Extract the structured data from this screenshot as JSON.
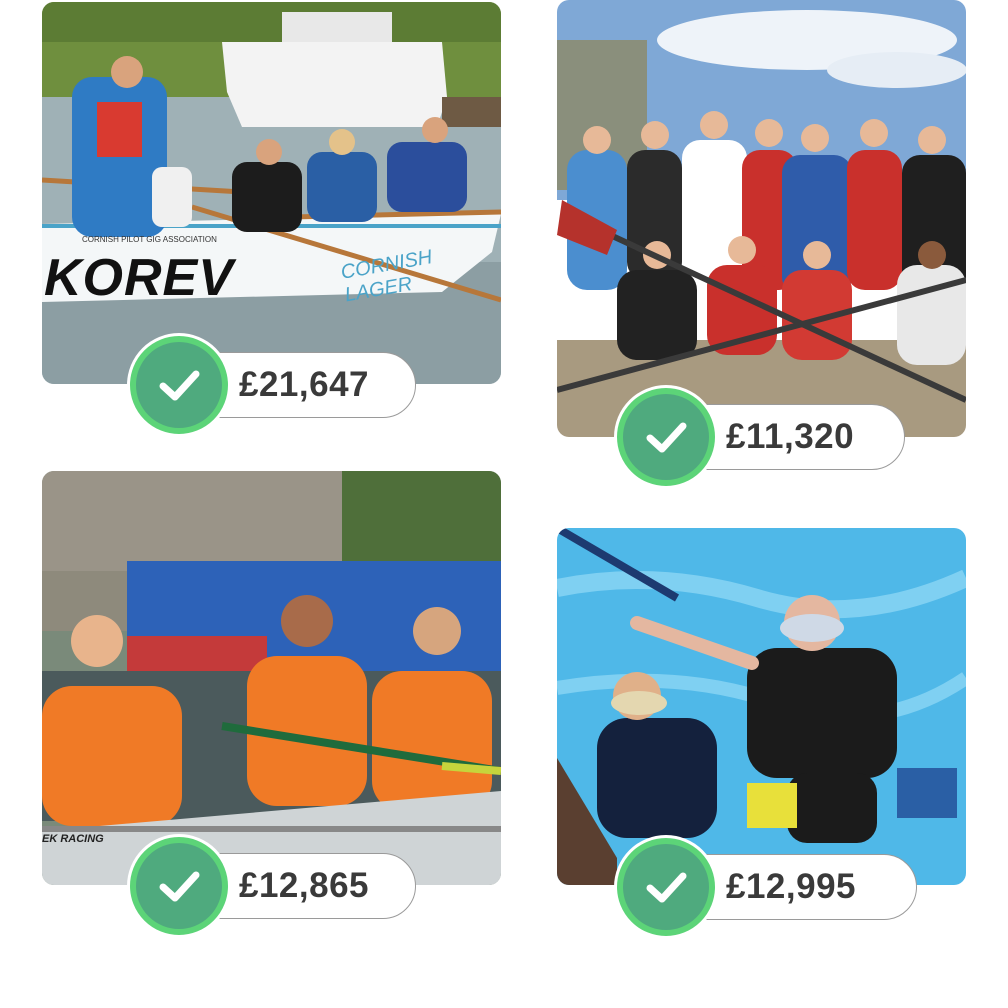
{
  "cards": [
    {
      "amount": "£21,647",
      "image": "rowing-gig-photo",
      "status": "funded"
    },
    {
      "amount": "£11,320",
      "image": "rowing-club-group-photo",
      "status": "funded"
    },
    {
      "amount": "£12,865",
      "image": "womens-rowing-crew-photo",
      "status": "funded"
    },
    {
      "amount": "£12,995",
      "image": "scuba-diving-pool-photo",
      "status": "funded"
    }
  ],
  "photo_text": {
    "boat_name": "KOREV",
    "boat_side": "CORNISH LAGER",
    "boat_association": "CORNISH PILOT GIG ASSOCIATION",
    "boat_racing": "EK RACING"
  },
  "colors": {
    "check_fill": "#4faa7e",
    "check_ring": "#5cd478",
    "pill_border": "#9a9a9a",
    "amount_text": "#3a3a3a"
  },
  "icons": {
    "status": "checkmark-icon"
  }
}
